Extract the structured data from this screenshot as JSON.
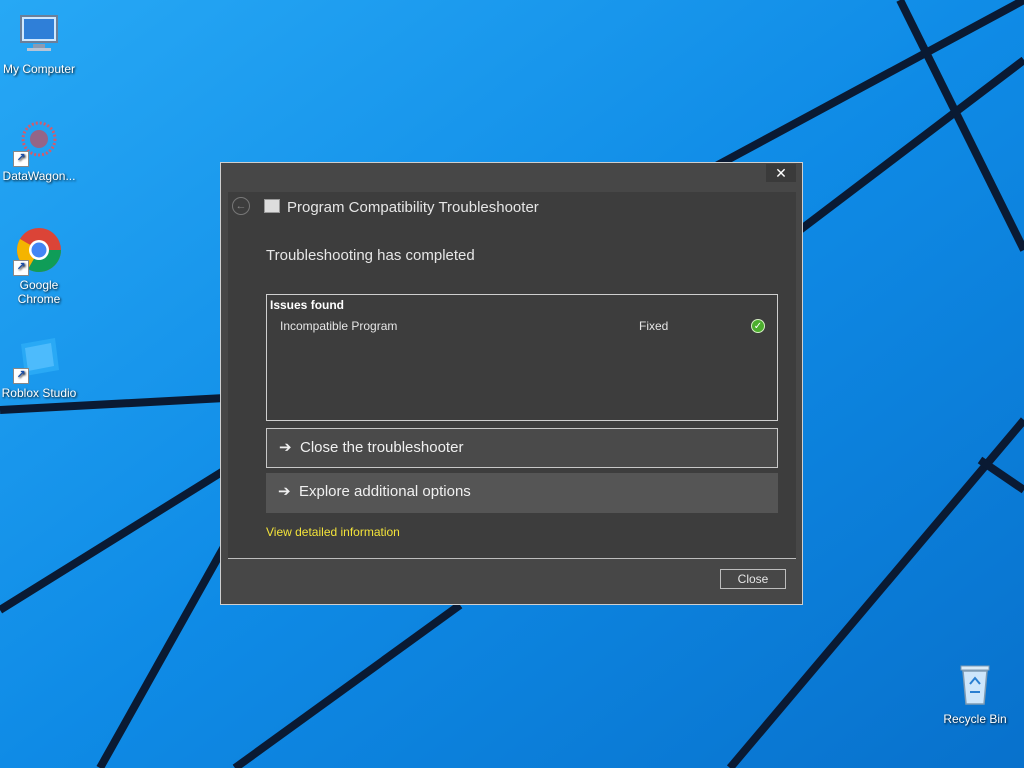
{
  "desktop": {
    "icons": [
      {
        "label": "My Computer",
        "icon": "computer-icon"
      },
      {
        "label": "DataWagon...",
        "icon": "datawagon-icon"
      },
      {
        "label": "Google Chrome",
        "icon": "chrome-icon"
      },
      {
        "label": "Roblox Studio",
        "icon": "roblox-studio-icon"
      },
      {
        "label": "Recycle Bin",
        "icon": "recycle-bin-icon"
      }
    ],
    "wallpaper_color": "#0b8be8"
  },
  "dialog": {
    "close_glyph": "✕",
    "app_title": "Program Compatibility Troubleshooter",
    "heading": "Troubleshooting has completed",
    "issues": {
      "title": "Issues found",
      "items": [
        {
          "name": "Incompatible Program",
          "status": "Fixed",
          "icon": "check-icon"
        }
      ]
    },
    "commands": [
      {
        "label": "Close the troubleshooter"
      },
      {
        "label": "Explore additional options"
      }
    ],
    "detail_link": "View detailed information",
    "close_button": "Close",
    "accent_link_color": "#f3e33a"
  }
}
